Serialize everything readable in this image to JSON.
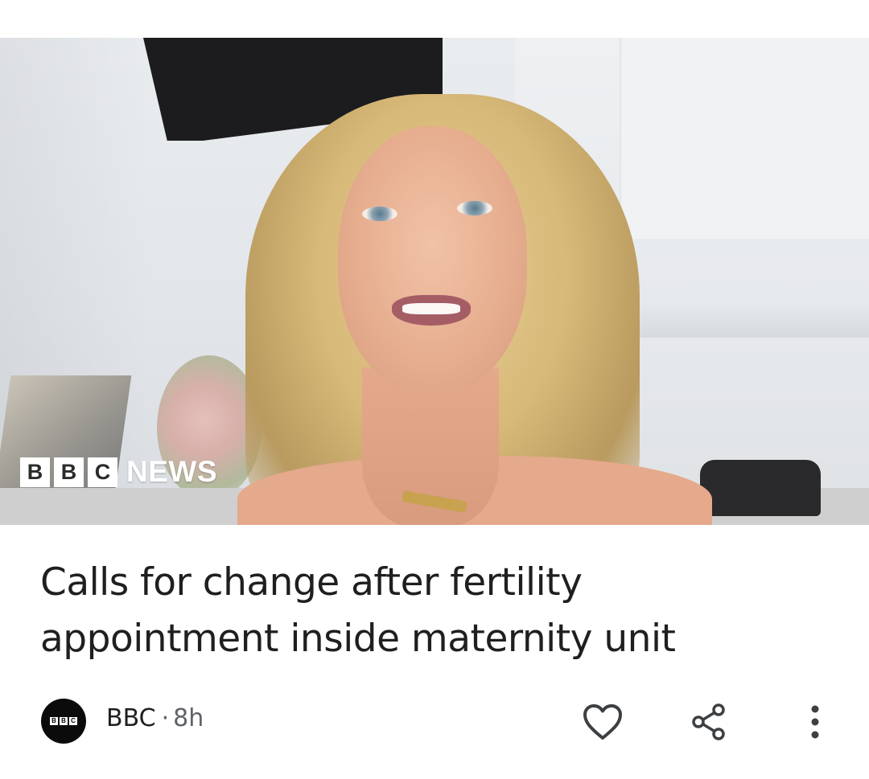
{
  "card": {
    "image": {
      "alt": "",
      "logo_letters": [
        "B",
        "B",
        "C"
      ],
      "logo_word": "NEWS"
    },
    "headline": "Calls for change after fertility appointment inside maternity unit",
    "source": {
      "avatar_letters": [
        "B",
        "B",
        "C"
      ],
      "name": "BBC",
      "separator": "·",
      "time": "8h"
    },
    "actions": {
      "like_icon": "heart-outline-icon",
      "share_icon": "share-icon",
      "more_icon": "more-vert-icon"
    }
  },
  "colors": {
    "text": "#1f1f1f",
    "secondary_text": "#5f6368",
    "background": "#ffffff",
    "avatar_bg": "#0b0b0b"
  }
}
